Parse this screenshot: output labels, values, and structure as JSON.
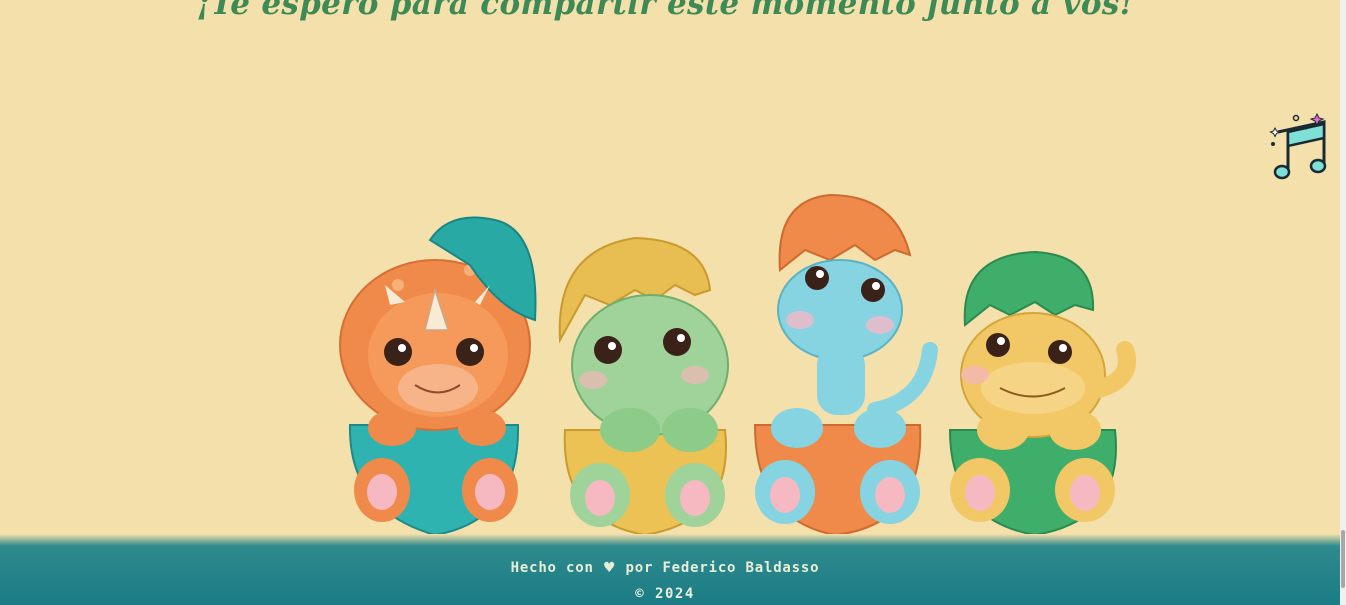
{
  "headline": "¡Te espero para compartir este momento junto a vos!",
  "music_button": {
    "icon": "music-note-icon"
  },
  "illustration": {
    "dinos": [
      "triceratops-orange",
      "trex-green",
      "brachiosaurus-blue",
      "dino-yellow"
    ]
  },
  "footer": {
    "made_with": "Hecho con",
    "heart": "♥",
    "by": "por Federico Baldasso",
    "copyright": "© 2024"
  },
  "colors": {
    "background": "#f4e0ab",
    "headline": "#3d8a57",
    "footer": "#1b7c86",
    "footer_text": "#e9eed7"
  }
}
